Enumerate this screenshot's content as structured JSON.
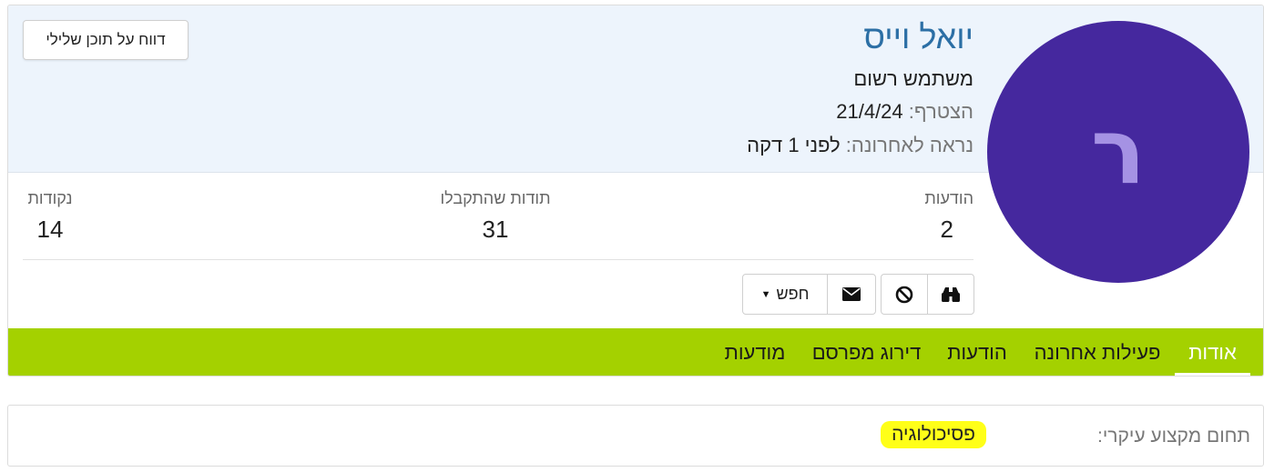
{
  "profile": {
    "avatar_letter": "ר",
    "name": "יואל וייס",
    "role": "משתמש רשום",
    "joined_label": "הצטרף:",
    "joined_value": "21/4/24",
    "last_seen_label": "נראה לאחרונה:",
    "last_seen_value": "לפני 1 דקה",
    "report_button": "דווח על תוכן שלילי"
  },
  "stats": {
    "posts_label": "הודעות",
    "posts_value": "2",
    "likes_label": "תודות שהתקבלו",
    "likes_value": "31",
    "points_label": "נקודות",
    "points_value": "14"
  },
  "actions": {
    "search_label": "חפש",
    "icons": [
      "binoculars-icon",
      "ban-icon",
      "envelope-icon",
      "caret-down-icon"
    ]
  },
  "tabs": [
    {
      "label": "אודות",
      "active": true
    },
    {
      "label": "פעילות אחרונה",
      "active": false
    },
    {
      "label": "הודעות",
      "active": false
    },
    {
      "label": "דירוג מפרסם",
      "active": false
    },
    {
      "label": "מודעות",
      "active": false
    }
  ],
  "about": {
    "field_label": "תחום מקצוע עיקרי:",
    "field_value": "פסיכולוגיה"
  },
  "colors": {
    "avatar_bg": "#45289e",
    "avatar_letter": "#a592e4",
    "name": "#2c6fa5",
    "tabs_bar": "#a4d100",
    "header_band": "#edf4fc",
    "highlight": "#ffff18"
  }
}
